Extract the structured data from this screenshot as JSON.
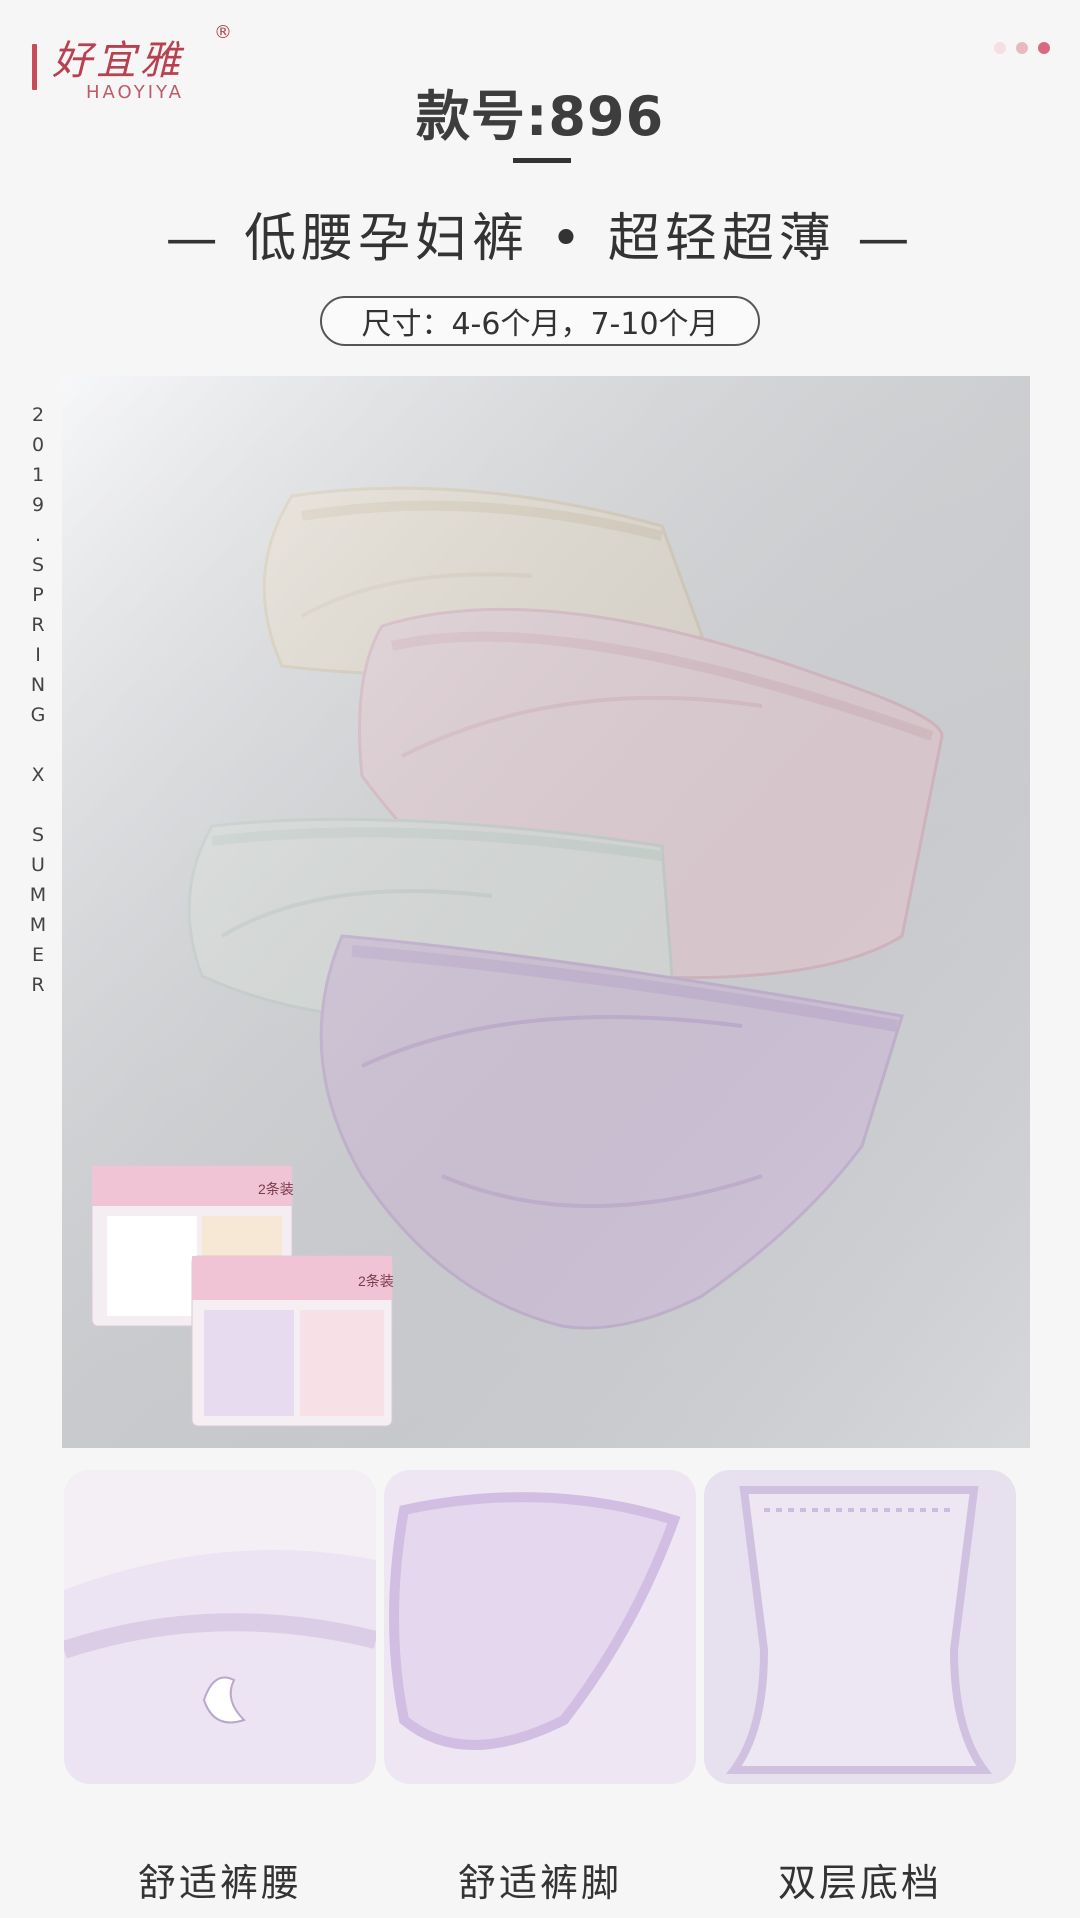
{
  "brand": {
    "name_cn": "好宜雅",
    "name_en": "HAOYIYA",
    "registered_mark": "®"
  },
  "header": {
    "model": "款号:896",
    "subtitle": "— 低腰孕妇裤 • 超轻超薄 —",
    "size": "尺寸：4-6个月，7-10个月"
  },
  "side_text": [
    "2",
    "0",
    "1",
    "9",
    ".",
    "S",
    "P",
    "R",
    "I",
    "N",
    "G",
    "",
    "X",
    "",
    "S",
    "U",
    "M",
    "M",
    "E",
    "R"
  ],
  "package": {
    "label": "2条装"
  },
  "features": [
    {
      "label": "舒适裤腰",
      "icon": "waistband-detail"
    },
    {
      "label": "舒适裤脚",
      "icon": "leg-opening-detail"
    },
    {
      "label": "双层底档",
      "icon": "double-crotch-detail"
    }
  ],
  "colors": {
    "brand": "#b8404f",
    "dots": [
      "#f4dfe3",
      "#eab8c0",
      "#d66b80"
    ],
    "cream": "#f6efe2",
    "pink": "#f7e3ea",
    "mint": "#eaf2f0",
    "lilac": "#e6d8f0"
  }
}
